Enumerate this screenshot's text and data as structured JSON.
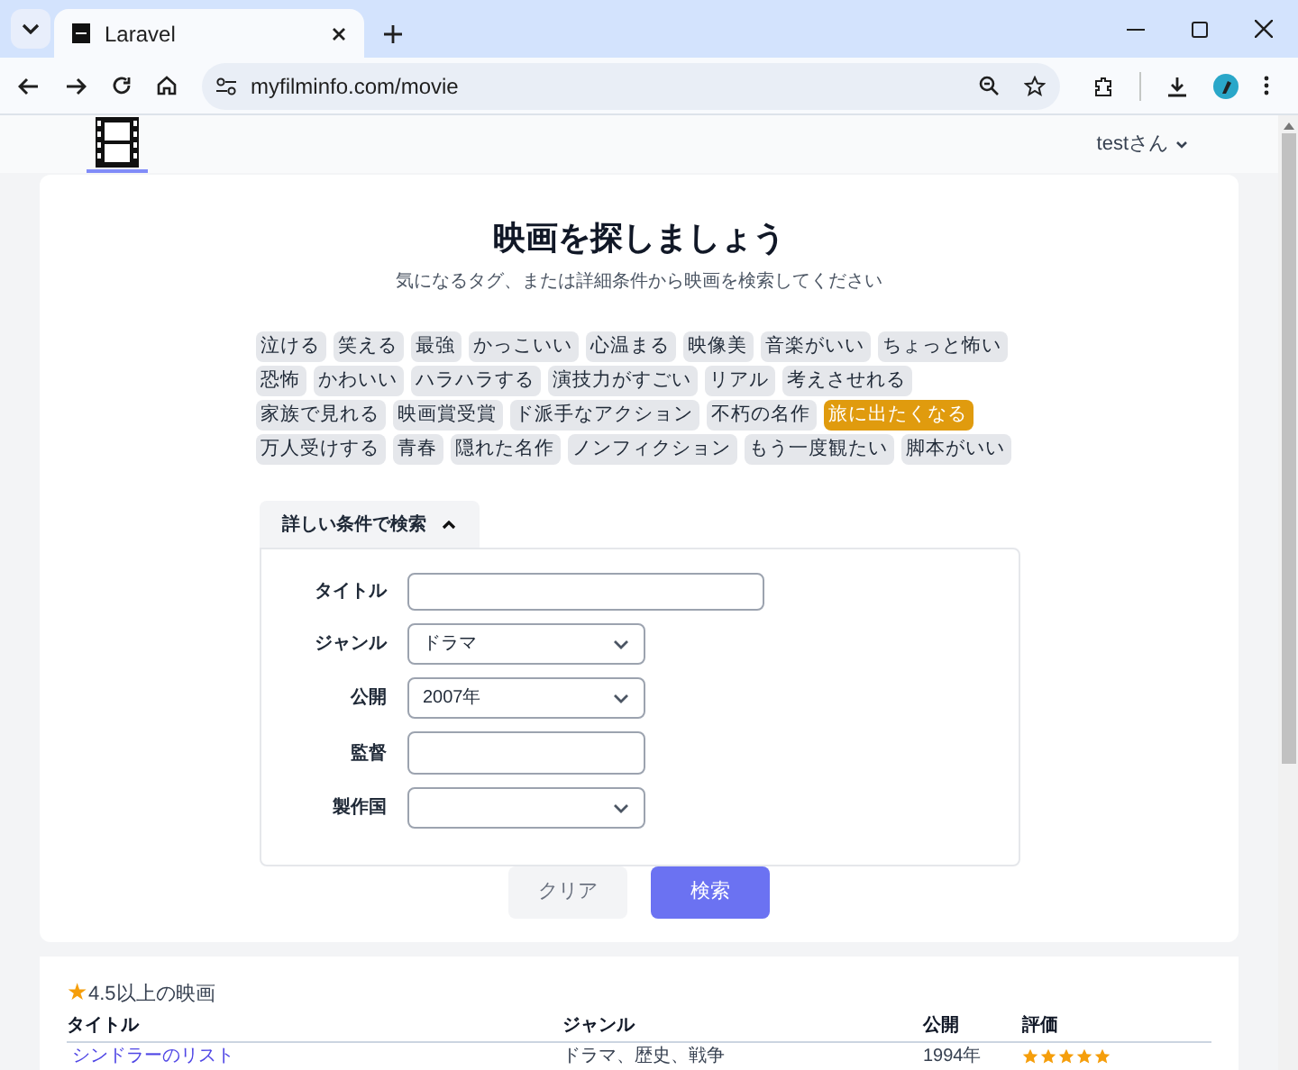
{
  "browser": {
    "tab_title": "Laravel",
    "url": "myfilminfo.com/movie"
  },
  "header": {
    "user_menu": "testさん"
  },
  "search": {
    "title": "映画を探しましょう",
    "subtitle": "気になるタグ、または詳細条件から映画を検索してください",
    "tags": [
      {
        "label": "泣ける",
        "selected": false
      },
      {
        "label": "笑える",
        "selected": false
      },
      {
        "label": "最強",
        "selected": false
      },
      {
        "label": "かっこいい",
        "selected": false
      },
      {
        "label": "心温まる",
        "selected": false
      },
      {
        "label": "映像美",
        "selected": false
      },
      {
        "label": "音楽がいい",
        "selected": false
      },
      {
        "label": "ちょっと怖い",
        "selected": false
      },
      {
        "label": "恐怖",
        "selected": false
      },
      {
        "label": "かわいい",
        "selected": false
      },
      {
        "label": "ハラハラする",
        "selected": false
      },
      {
        "label": "演技力がすごい",
        "selected": false
      },
      {
        "label": "リアル",
        "selected": false
      },
      {
        "label": "考えさせれる",
        "selected": false
      },
      {
        "label": "家族で見れる",
        "selected": false
      },
      {
        "label": "映画賞受賞",
        "selected": false
      },
      {
        "label": "ド派手なアクション",
        "selected": false
      },
      {
        "label": "不朽の名作",
        "selected": false
      },
      {
        "label": "旅に出たくなる",
        "selected": true
      },
      {
        "label": "万人受けする",
        "selected": false
      },
      {
        "label": "青春",
        "selected": false
      },
      {
        "label": "隠れた名作",
        "selected": false
      },
      {
        "label": "ノンフィクション",
        "selected": false
      },
      {
        "label": "もう一度観たい",
        "selected": false
      },
      {
        "label": "脚本がいい",
        "selected": false
      }
    ],
    "advanced": {
      "label": "詳しい条件で検索",
      "expanded": true,
      "fields": [
        {
          "kind": "text",
          "label": "タイトル",
          "wide": true
        },
        {
          "kind": "select",
          "label": "ジャンル",
          "value": "ドラマ"
        },
        {
          "kind": "select",
          "label": "公開",
          "value": "2007年"
        },
        {
          "kind": "text",
          "label": "監督"
        },
        {
          "kind": "select",
          "label": "製作国"
        }
      ]
    },
    "buttons": [
      {
        "kind": "secondary",
        "label": "クリア"
      },
      {
        "kind": "primary",
        "label": "検索"
      }
    ]
  },
  "top_rated": {
    "heading_icon": "★",
    "heading": "4.5以上の映画",
    "columns": [
      "タイトル",
      "ジャンル",
      "公開",
      "評価"
    ],
    "rows": [
      {
        "title": "シンドラーのリスト",
        "genre": "ドラマ、歴史、戦争",
        "released": "1994年",
        "stars": 5
      }
    ]
  }
}
